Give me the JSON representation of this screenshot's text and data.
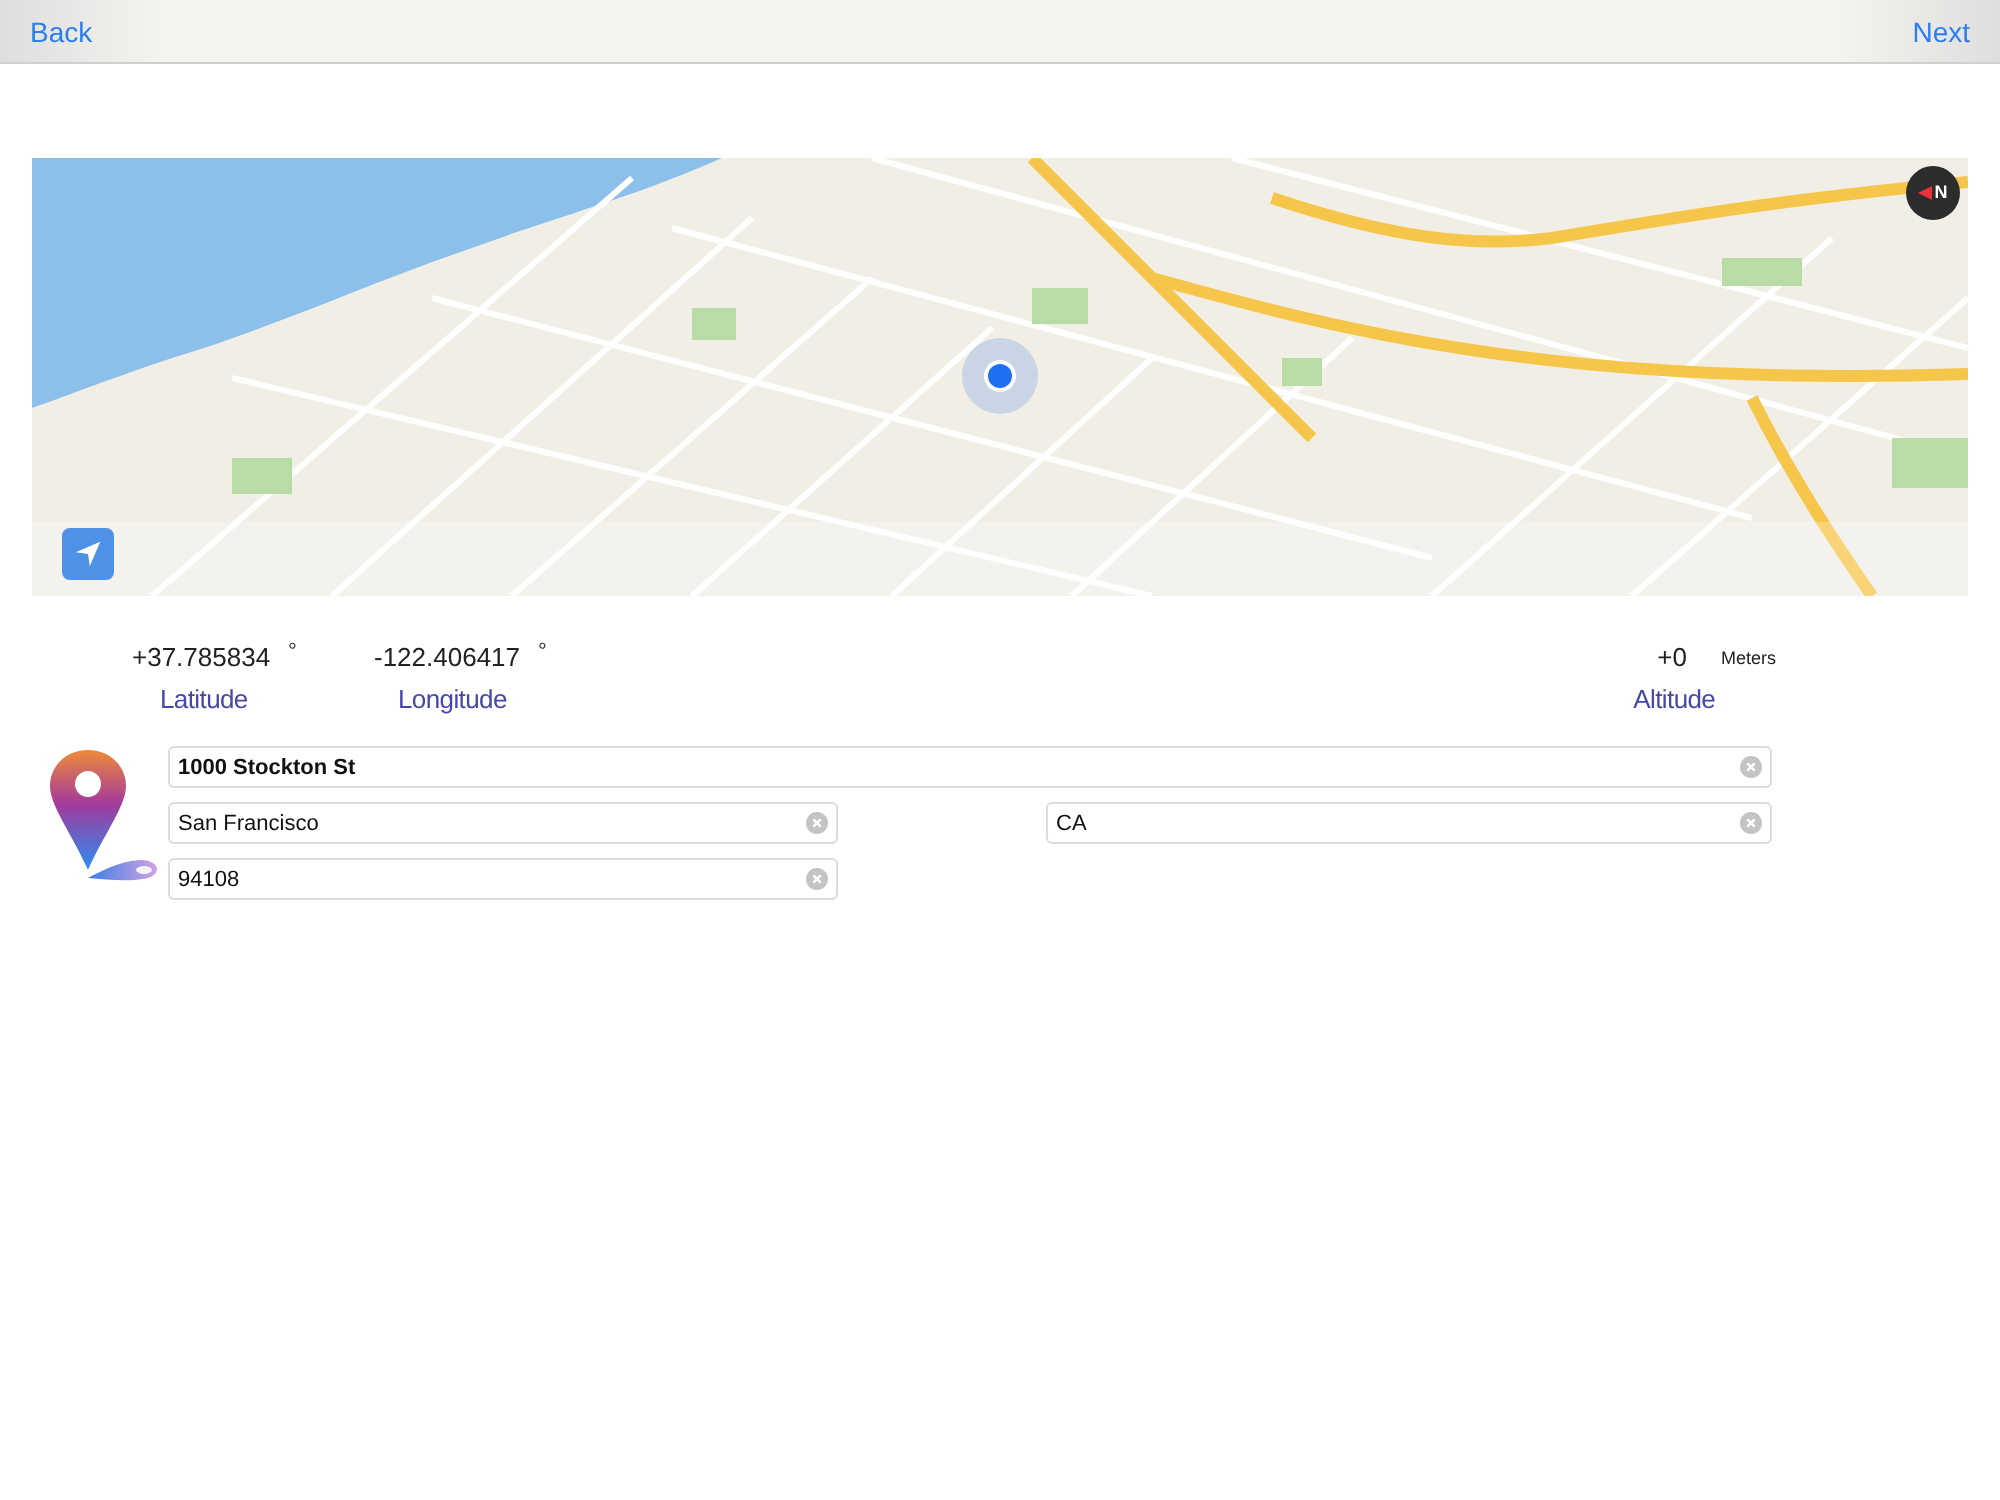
{
  "nav": {
    "back": "Back",
    "next": "Next"
  },
  "map": {
    "compass": "N"
  },
  "coordinates": [
    {
      "value": "+37.785834",
      "unit": "°",
      "label": "Latitude",
      "kind": "latitude"
    },
    {
      "value": "-122.406417",
      "unit": "°",
      "label": "Longitude",
      "kind": "longitude"
    },
    {
      "value": "+0",
      "unit": "Meters",
      "label": "Altitude",
      "kind": "altitude"
    }
  ],
  "address": [
    {
      "kind": "street",
      "value": "1000 Stockton St"
    },
    {
      "kind": "city",
      "value": "San Francisco"
    },
    {
      "kind": "state",
      "value": "CA"
    },
    {
      "kind": "zip",
      "value": "94108"
    }
  ]
}
